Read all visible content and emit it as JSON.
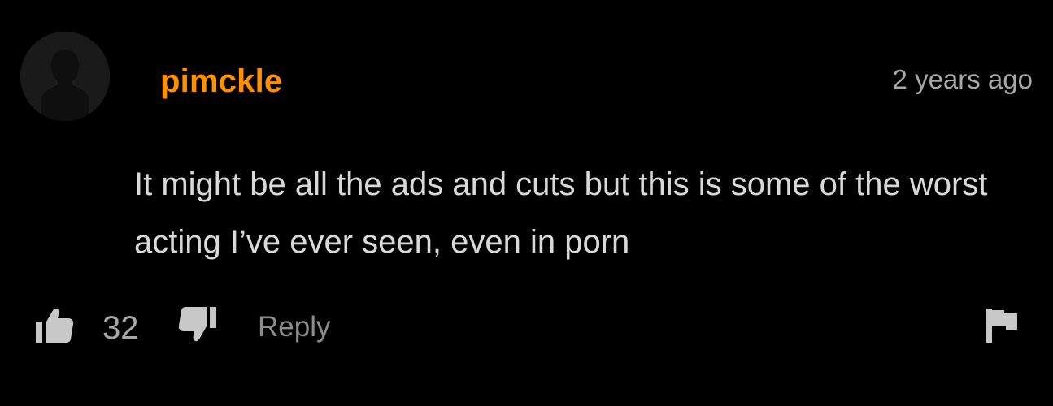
{
  "comment": {
    "username": "pimckle",
    "timestamp": "2 years ago",
    "text": "It might be all the ads and cuts but this is some of the worst acting I’ve ever seen, even in porn",
    "vote_count": "32",
    "reply_label": "Reply"
  },
  "icons": {
    "avatar": "default-user-silhouette",
    "upvote": "thumbs-up-icon",
    "downvote": "thumbs-down-icon",
    "report": "flag-icon"
  },
  "colors": {
    "background": "#000000",
    "username": "#ff9000",
    "body_text": "#d9d9d9",
    "muted_text": "#a8a8a8",
    "icon": "#c8c8c8"
  }
}
